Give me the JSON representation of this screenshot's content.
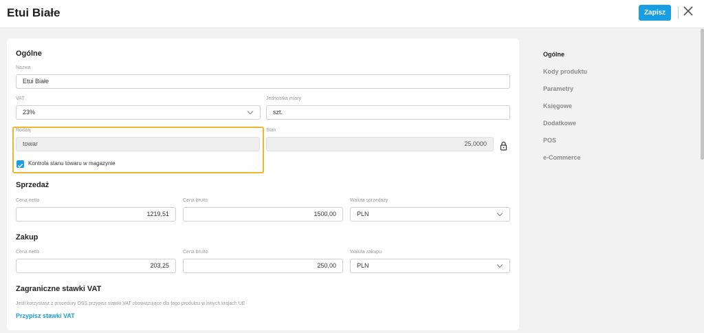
{
  "header": {
    "title": "Etui Białe",
    "save_label": "Zapisz"
  },
  "general": {
    "section_title": "Ogólne",
    "name_label": "Nazwa",
    "name_value": "Etui Białe",
    "vat_label": "VAT",
    "vat_value": "23%",
    "unit_label": "Jednostka miary",
    "unit_value": "szt.",
    "type_label": "Rodzaj",
    "type_value": "towar",
    "stock_label": "Stan",
    "stock_value": "25,0000",
    "stock_control_label": "Kontrola stanu towaru w magazynie",
    "stock_control_checked": true
  },
  "sales": {
    "section_title": "Sprzedaż",
    "net_label": "Cena netto",
    "net_value": "1219,51",
    "gross_label": "Cena brutto",
    "gross_value": "1500,00",
    "currency_label": "Waluta sprzedaży",
    "currency_value": "PLN"
  },
  "purchase": {
    "section_title": "Zakup",
    "net_label": "Cena netto",
    "net_value": "203,25",
    "gross_label": "Cena brutto",
    "gross_value": "250,00",
    "currency_label": "Waluta zakupu",
    "currency_value": "PLN"
  },
  "foreign_vat": {
    "section_title": "Zagraniczne stawki VAT",
    "hint": "Jeśli korzystasz z procedury OSS przypisz stawki VAT obowiązujące dla tego produktu w innych krajach UE",
    "link_label": "Przypisz stawki VAT"
  },
  "side_nav": {
    "items": [
      "Ogólne",
      "Kody produktu",
      "Parametry",
      "Księgowe",
      "Dodatkowe",
      "POS",
      "e-Commerce"
    ],
    "active": "Ogólne"
  },
  "colors": {
    "accent": "#1a9ee3",
    "highlight": "#f0b52e"
  }
}
